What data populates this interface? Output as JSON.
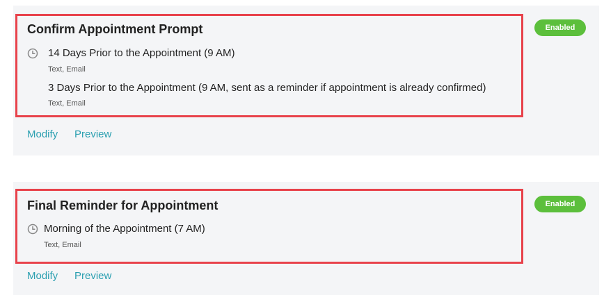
{
  "notifications": [
    {
      "title": "Confirm Appointment Prompt",
      "status": "Enabled",
      "schedules": [
        {
          "timing": "14 Days Prior to the Appointment (9 AM)",
          "channels": "Text, Email"
        },
        {
          "timing": "3 Days Prior to the Appointment (9 AM, sent as a reminder if appointment is already confirmed)",
          "channels": "Text, Email"
        }
      ],
      "actions": {
        "modify": "Modify",
        "preview": "Preview"
      }
    },
    {
      "title": "Final Reminder for Appointment",
      "status": "Enabled",
      "schedules": [
        {
          "timing": "Morning of the Appointment (7 AM)",
          "channels": "Text, Email"
        }
      ],
      "actions": {
        "modify": "Modify",
        "preview": "Preview"
      }
    }
  ],
  "colors": {
    "badge": "#5cbf3c",
    "link": "#2a9fb0",
    "highlight": "#e8424b",
    "card": "#f4f5f7"
  },
  "icons": {
    "schedule": "clock-icon"
  }
}
